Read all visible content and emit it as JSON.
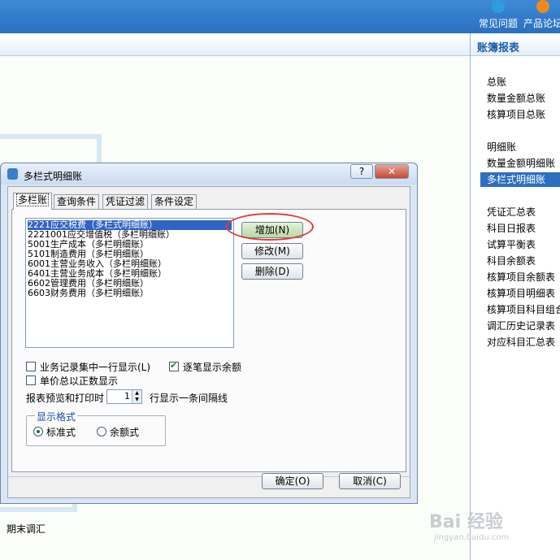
{
  "topbar": {
    "buttons": [
      {
        "label": "常见问题",
        "icon": "question-icon",
        "color": "#2e9de0"
      },
      {
        "label": "产品论坛",
        "icon": "forum-icon",
        "color": "#f08a1c"
      }
    ]
  },
  "right_panel": {
    "title": "账簿报表",
    "groups": [
      [
        "总账",
        "数量金额总账",
        "核算项目总账"
      ],
      [
        "明细账",
        "数量金额明细账",
        "多栏式明细账"
      ],
      [
        "凭证汇总表",
        "科目日报表",
        "试算平衡表",
        "科目余额表",
        "核算项目余额表",
        "核算项目明细表",
        "核算项目科目组合",
        "调汇历史记录表",
        "对应科目汇总表"
      ]
    ],
    "selected": "多栏式明细账"
  },
  "dialog": {
    "title": "多栏式明细账",
    "help_label": "?",
    "close_label": "✕",
    "tabs": [
      "多栏账",
      "查询条件",
      "凭证过滤",
      "条件设定"
    ],
    "active_tab": "多栏账",
    "list_items": [
      "2221应交税费（多栏式明细账）",
      "2221001应交增值税（多栏明细账）",
      "5001生产成本（多栏明细账）",
      "5101制造费用（多栏明细账）",
      "6001主营业务收入（多栏明细账）",
      "6401主营业务成本（多栏明细账）",
      "6602管理费用（多栏明细账）",
      "6603财务费用（多栏明细账）"
    ],
    "selected_item_index": 0,
    "buttons": {
      "add": "增加(N)",
      "edit": "修改(M)",
      "delete": "删除(D)"
    },
    "options": {
      "merge_one_line": {
        "label": "业务记录集中一行显示(L)",
        "checked": false
      },
      "show_balance": {
        "label": "逐笔显示余额",
        "checked": true
      },
      "unit_price_positive": {
        "label": "单价总以正数显示",
        "checked": false
      }
    },
    "print_row_prefix": "报表预览和打印时",
    "print_row_value": "1",
    "print_row_suffix": "行显示一条间隔线",
    "format_group": {
      "legend": "显示格式",
      "standard": "标准式",
      "balance": "余额式",
      "selected": "标准式"
    },
    "ok_label": "确定(O)",
    "cancel_label": "取消(C)"
  },
  "bottom_item": "期末调汇",
  "watermark": {
    "main": "Bai 经验",
    "sub": "jingyan.baidu.com"
  }
}
